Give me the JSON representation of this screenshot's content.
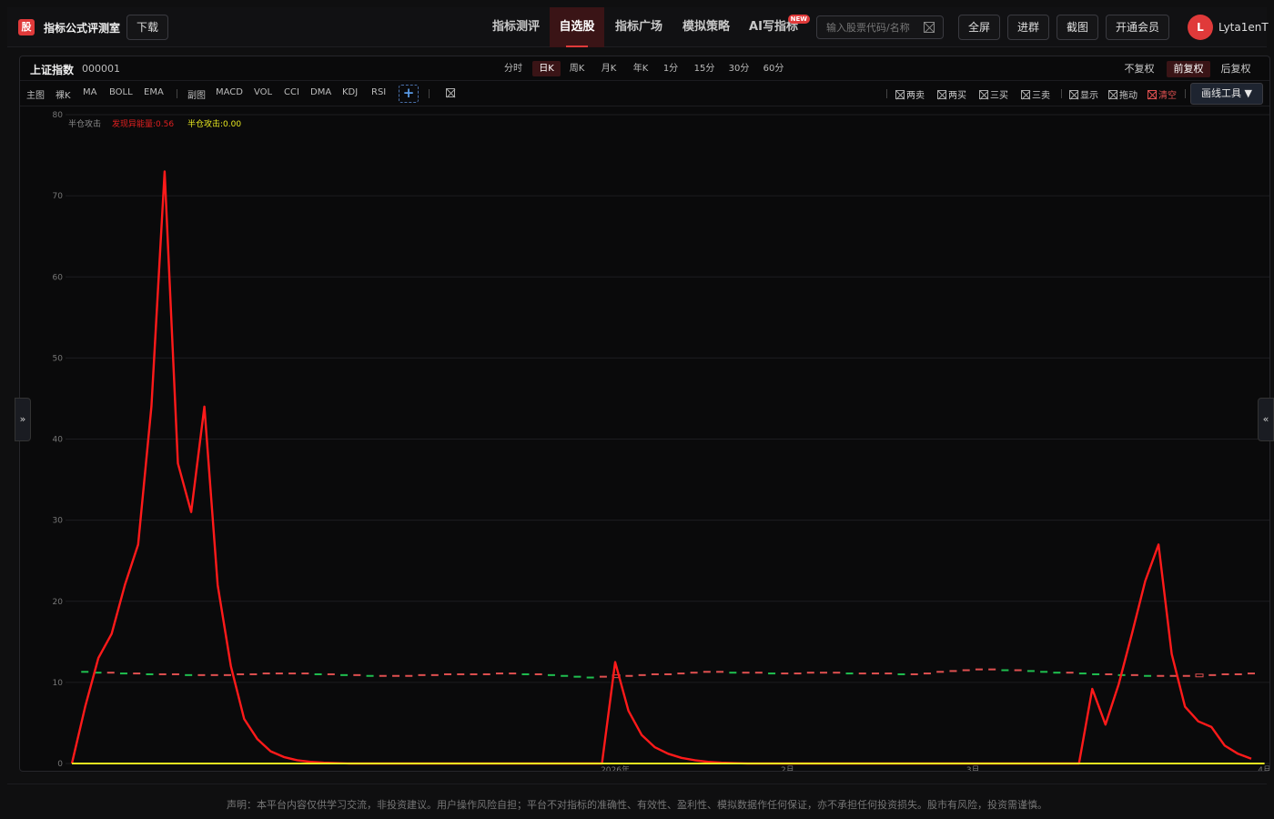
{
  "app": {
    "logo": "股",
    "title": "指标公式评测室",
    "download": "下载"
  },
  "nav": [
    {
      "label": "指标测评",
      "active": false
    },
    {
      "label": "自选股",
      "active": true
    },
    {
      "label": "指标广场",
      "active": false
    },
    {
      "label": "模拟策略",
      "active": false
    },
    {
      "label": "AI写指标",
      "active": false,
      "badge": "NEW"
    }
  ],
  "search": {
    "placeholder": "输入股票代码/名称",
    "value": ""
  },
  "top_buttons": [
    "全屏",
    "进群",
    "截图",
    "开通会员"
  ],
  "user": {
    "avatar_letter": "L",
    "name": "Lyta1enT"
  },
  "stock": {
    "name": "上证指数",
    "code": "000001"
  },
  "periods": [
    {
      "label": "分时",
      "active": false
    },
    {
      "label": "日K",
      "active": true
    },
    {
      "label": "周K",
      "active": false
    },
    {
      "label": "月K",
      "active": false
    },
    {
      "label": "年K",
      "active": false
    },
    {
      "label": "1分",
      "active": false
    },
    {
      "label": "15分",
      "active": false
    },
    {
      "label": "30分",
      "active": false
    },
    {
      "label": "60分",
      "active": false
    }
  ],
  "adjustments": [
    {
      "label": "不复权",
      "active": false
    },
    {
      "label": "前复权",
      "active": true
    },
    {
      "label": "后复权",
      "active": false
    }
  ],
  "main_indicators": {
    "label": "主图",
    "items": [
      "裸K",
      "MA",
      "BOLL",
      "EMA"
    ]
  },
  "sub_indicators": {
    "label": "副图",
    "items": [
      "MACD",
      "VOL",
      "CCI",
      "DMA",
      "KDJ",
      "RSI"
    ]
  },
  "add_button": "+",
  "signal_toggles": [
    "两卖",
    "两买",
    "三买",
    "三卖"
  ],
  "view_toggles": [
    "显示",
    "拖动"
  ],
  "clear_toggle": "清空",
  "draw_tool": "画线工具 ▼",
  "left_handle": "»",
  "right_handle": "«",
  "disclaimer": "声明：本平台内容仅供学习交流，非投资建议。用户操作风险自担；平台不对指标的准确性、有效性、盈利性、模拟数据作任何保证，亦不承担任何投资损失。股市有风险，投资需谨慎。",
  "chart_data": {
    "type": "line",
    "ylim": [
      0,
      80
    ],
    "y_ticks": [
      0,
      10,
      20,
      30,
      40,
      50,
      60,
      70,
      80
    ],
    "x_tick_labels": [
      {
        "label": "2026年",
        "index": 41
      },
      {
        "label": "2月",
        "index": 54
      },
      {
        "label": "3月",
        "index": 68
      },
      {
        "label": "4月",
        "index": 90
      }
    ],
    "legend": [
      {
        "text": "半仓攻击",
        "color": "#8a8a8a"
      },
      {
        "text": "发现异能量:0.56",
        "color": "#e02020"
      },
      {
        "text": "半仓攻击:0.00",
        "color": "#e8e820"
      }
    ],
    "grid": true,
    "series": [
      {
        "name": "发现异能量",
        "color": "#ff1a1a",
        "values": [
          0,
          7,
          13,
          16,
          22,
          27,
          44,
          73,
          37,
          31,
          44,
          22,
          12,
          5.5,
          3,
          1.5,
          0.8,
          0.4,
          0.2,
          0.1,
          0.05,
          0,
          0,
          0,
          0,
          0,
          0,
          0,
          0,
          0,
          0,
          0,
          0,
          0,
          0,
          0,
          0,
          0,
          0,
          0,
          0,
          12.5,
          6.5,
          3.5,
          2,
          1.2,
          0.7,
          0.4,
          0.2,
          0.1,
          0.05,
          0,
          0,
          0,
          0,
          0,
          0,
          0,
          0,
          0,
          0,
          0,
          0,
          0,
          0,
          0,
          0,
          0,
          0,
          0,
          0,
          0,
          0,
          0,
          0,
          0,
          0,
          9.2,
          4.8,
          9.8,
          16,
          22.5,
          27,
          13.5,
          7,
          5.2,
          4.5,
          2.2,
          1.2,
          0.6
        ]
      },
      {
        "name": "半仓攻击",
        "color": "#e8e820",
        "values": [
          0,
          0,
          0,
          0,
          0,
          0,
          0,
          0,
          0,
          0,
          0,
          0,
          0,
          0,
          0,
          0,
          0,
          0,
          0,
          0,
          0,
          0,
          0,
          0,
          0,
          0,
          0,
          0,
          0,
          0,
          0,
          0,
          0,
          0,
          0,
          0,
          0,
          0,
          0,
          0,
          0,
          0,
          0,
          0,
          0,
          0,
          0,
          0,
          0,
          0,
          0,
          0,
          0,
          0,
          0,
          0,
          0,
          0,
          0,
          0,
          0,
          0,
          0,
          0,
          0,
          0,
          0,
          0,
          0,
          0,
          0,
          0,
          0,
          0,
          0,
          0,
          0,
          0,
          0,
          0,
          0,
          0,
          0,
          0,
          0,
          0,
          0,
          0,
          0,
          0,
          0
        ]
      }
    ],
    "candles": [
      11.4,
      11.3,
      11.2,
      11.2,
      11.1,
      11.1,
      11.0,
      11.0,
      11.0,
      10.9,
      10.9,
      10.9,
      10.9,
      11.0,
      11.0,
      11.1,
      11.1,
      11.1,
      11.1,
      11.0,
      11.0,
      10.9,
      10.9,
      10.8,
      10.8,
      10.8,
      10.8,
      10.9,
      10.9,
      11.0,
      11.0,
      11.0,
      11.0,
      11.1,
      11.1,
      11.0,
      11.0,
      10.9,
      10.8,
      10.7,
      10.6,
      10.7,
      10.7,
      10.8,
      10.9,
      11.0,
      11.0,
      11.1,
      11.2,
      11.3,
      11.3,
      11.2,
      11.2,
      11.2,
      11.1,
      11.1,
      11.1,
      11.2,
      11.2,
      11.2,
      11.1,
      11.1,
      11.1,
      11.1,
      11.0,
      11.0,
      11.1,
      11.3,
      11.4,
      11.5,
      11.6,
      11.6,
      11.5,
      11.5,
      11.4,
      11.3,
      11.2,
      11.2,
      11.1,
      11.0,
      11.0,
      10.9,
      10.9,
      10.8,
      10.8,
      10.8,
      10.8,
      10.8,
      10.9,
      11.0,
      11.0,
      11.1
    ]
  }
}
